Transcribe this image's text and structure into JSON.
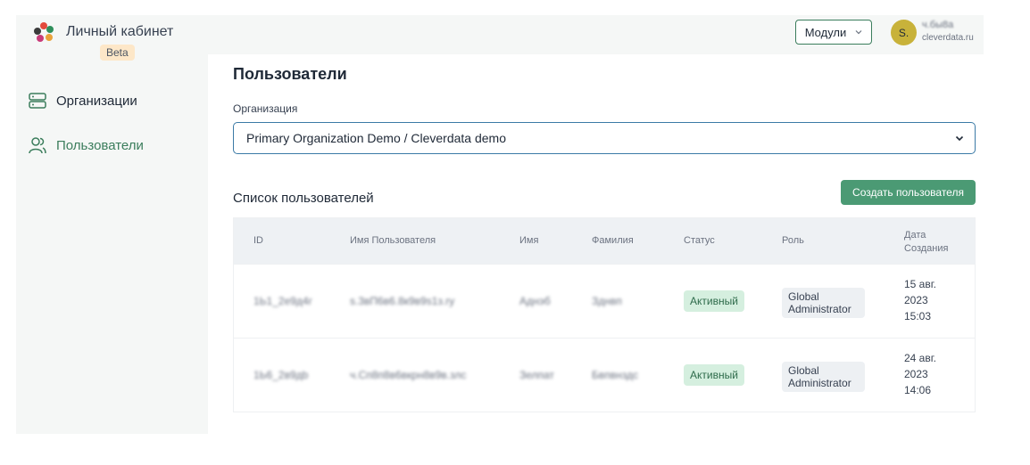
{
  "sidebar": {
    "app_title": "Личный кабинет",
    "beta_badge": "Beta",
    "items": [
      {
        "label": "Организации",
        "icon": "server-icon",
        "active": false
      },
      {
        "label": "Пользователи",
        "icon": "users-icon",
        "active": true
      }
    ]
  },
  "header": {
    "modules_label": "Модули",
    "avatar_initial": "S.",
    "user_name": "ч.бы8а",
    "user_domain": "cleverdata.ru"
  },
  "main": {
    "page_title": "Пользователи",
    "org_label": "Организация",
    "org_selected": "Primary Organization Demo / Cleverdata demo",
    "list_title": "Список пользователей",
    "create_button": "Создать пользователя"
  },
  "table": {
    "columns": [
      "ID",
      "Имя Пользователя",
      "Имя",
      "Фамилия",
      "Статус",
      "Роль",
      "Дата Создания"
    ],
    "rows": [
      {
        "id": "1Ь1_2е9д4г",
        "username": "s.3вП6в6.8к9в9s1з.rу",
        "first_name": "Аднэб",
        "last_name": "Зднвп",
        "status": "Активный",
        "role": "Global Administrator",
        "date": "15 авг.",
        "year": "2023",
        "time": "15:03"
      },
      {
        "id": "1Ь6_2в9дb",
        "username": "ч.Сп8п8в6вкрн8в9в.злс",
        "first_name": "Зелпат",
        "last_name": "Бвпвнздс",
        "status": "Активный",
        "role": "Global Administrator",
        "date": "24 авг.",
        "year": "2023",
        "time": "14:06"
      }
    ]
  },
  "colors": {
    "accent": "#3b7d5c",
    "button_bg": "#4b9a74",
    "badge_bg": "#d5efdf",
    "avatar_bg": "#c8b23a",
    "beta_bg": "#fde7c8"
  }
}
